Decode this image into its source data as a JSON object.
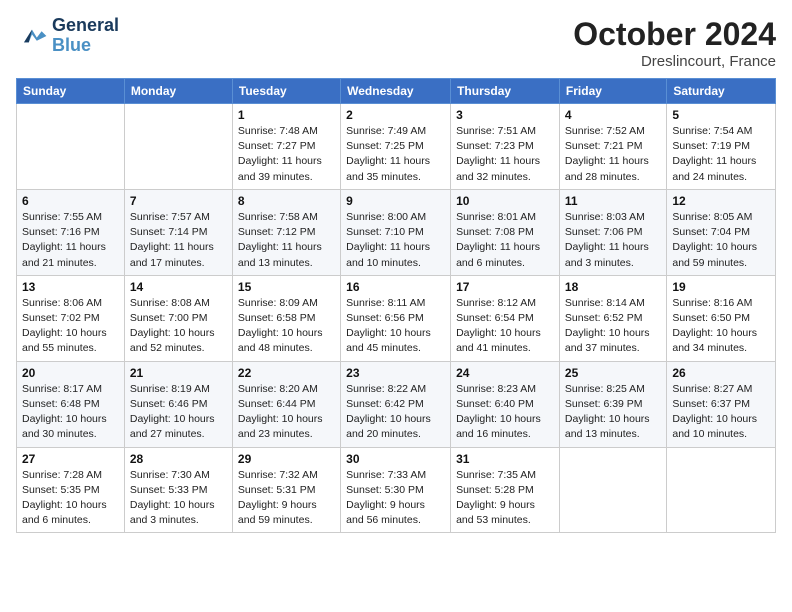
{
  "header": {
    "logo_line1": "General",
    "logo_line2": "Blue",
    "month": "October 2024",
    "location": "Dreslincourt, France"
  },
  "weekdays": [
    "Sunday",
    "Monday",
    "Tuesday",
    "Wednesday",
    "Thursday",
    "Friday",
    "Saturday"
  ],
  "weeks": [
    [
      {
        "day": "",
        "detail": ""
      },
      {
        "day": "",
        "detail": ""
      },
      {
        "day": "1",
        "detail": "Sunrise: 7:48 AM\nSunset: 7:27 PM\nDaylight: 11 hours and 39 minutes."
      },
      {
        "day": "2",
        "detail": "Sunrise: 7:49 AM\nSunset: 7:25 PM\nDaylight: 11 hours and 35 minutes."
      },
      {
        "day": "3",
        "detail": "Sunrise: 7:51 AM\nSunset: 7:23 PM\nDaylight: 11 hours and 32 minutes."
      },
      {
        "day": "4",
        "detail": "Sunrise: 7:52 AM\nSunset: 7:21 PM\nDaylight: 11 hours and 28 minutes."
      },
      {
        "day": "5",
        "detail": "Sunrise: 7:54 AM\nSunset: 7:19 PM\nDaylight: 11 hours and 24 minutes."
      }
    ],
    [
      {
        "day": "6",
        "detail": "Sunrise: 7:55 AM\nSunset: 7:16 PM\nDaylight: 11 hours and 21 minutes."
      },
      {
        "day": "7",
        "detail": "Sunrise: 7:57 AM\nSunset: 7:14 PM\nDaylight: 11 hours and 17 minutes."
      },
      {
        "day": "8",
        "detail": "Sunrise: 7:58 AM\nSunset: 7:12 PM\nDaylight: 11 hours and 13 minutes."
      },
      {
        "day": "9",
        "detail": "Sunrise: 8:00 AM\nSunset: 7:10 PM\nDaylight: 11 hours and 10 minutes."
      },
      {
        "day": "10",
        "detail": "Sunrise: 8:01 AM\nSunset: 7:08 PM\nDaylight: 11 hours and 6 minutes."
      },
      {
        "day": "11",
        "detail": "Sunrise: 8:03 AM\nSunset: 7:06 PM\nDaylight: 11 hours and 3 minutes."
      },
      {
        "day": "12",
        "detail": "Sunrise: 8:05 AM\nSunset: 7:04 PM\nDaylight: 10 hours and 59 minutes."
      }
    ],
    [
      {
        "day": "13",
        "detail": "Sunrise: 8:06 AM\nSunset: 7:02 PM\nDaylight: 10 hours and 55 minutes."
      },
      {
        "day": "14",
        "detail": "Sunrise: 8:08 AM\nSunset: 7:00 PM\nDaylight: 10 hours and 52 minutes."
      },
      {
        "day": "15",
        "detail": "Sunrise: 8:09 AM\nSunset: 6:58 PM\nDaylight: 10 hours and 48 minutes."
      },
      {
        "day": "16",
        "detail": "Sunrise: 8:11 AM\nSunset: 6:56 PM\nDaylight: 10 hours and 45 minutes."
      },
      {
        "day": "17",
        "detail": "Sunrise: 8:12 AM\nSunset: 6:54 PM\nDaylight: 10 hours and 41 minutes."
      },
      {
        "day": "18",
        "detail": "Sunrise: 8:14 AM\nSunset: 6:52 PM\nDaylight: 10 hours and 37 minutes."
      },
      {
        "day": "19",
        "detail": "Sunrise: 8:16 AM\nSunset: 6:50 PM\nDaylight: 10 hours and 34 minutes."
      }
    ],
    [
      {
        "day": "20",
        "detail": "Sunrise: 8:17 AM\nSunset: 6:48 PM\nDaylight: 10 hours and 30 minutes."
      },
      {
        "day": "21",
        "detail": "Sunrise: 8:19 AM\nSunset: 6:46 PM\nDaylight: 10 hours and 27 minutes."
      },
      {
        "day": "22",
        "detail": "Sunrise: 8:20 AM\nSunset: 6:44 PM\nDaylight: 10 hours and 23 minutes."
      },
      {
        "day": "23",
        "detail": "Sunrise: 8:22 AM\nSunset: 6:42 PM\nDaylight: 10 hours and 20 minutes."
      },
      {
        "day": "24",
        "detail": "Sunrise: 8:23 AM\nSunset: 6:40 PM\nDaylight: 10 hours and 16 minutes."
      },
      {
        "day": "25",
        "detail": "Sunrise: 8:25 AM\nSunset: 6:39 PM\nDaylight: 10 hours and 13 minutes."
      },
      {
        "day": "26",
        "detail": "Sunrise: 8:27 AM\nSunset: 6:37 PM\nDaylight: 10 hours and 10 minutes."
      }
    ],
    [
      {
        "day": "27",
        "detail": "Sunrise: 7:28 AM\nSunset: 5:35 PM\nDaylight: 10 hours and 6 minutes."
      },
      {
        "day": "28",
        "detail": "Sunrise: 7:30 AM\nSunset: 5:33 PM\nDaylight: 10 hours and 3 minutes."
      },
      {
        "day": "29",
        "detail": "Sunrise: 7:32 AM\nSunset: 5:31 PM\nDaylight: 9 hours and 59 minutes."
      },
      {
        "day": "30",
        "detail": "Sunrise: 7:33 AM\nSunset: 5:30 PM\nDaylight: 9 hours and 56 minutes."
      },
      {
        "day": "31",
        "detail": "Sunrise: 7:35 AM\nSunset: 5:28 PM\nDaylight: 9 hours and 53 minutes."
      },
      {
        "day": "",
        "detail": ""
      },
      {
        "day": "",
        "detail": ""
      }
    ]
  ]
}
